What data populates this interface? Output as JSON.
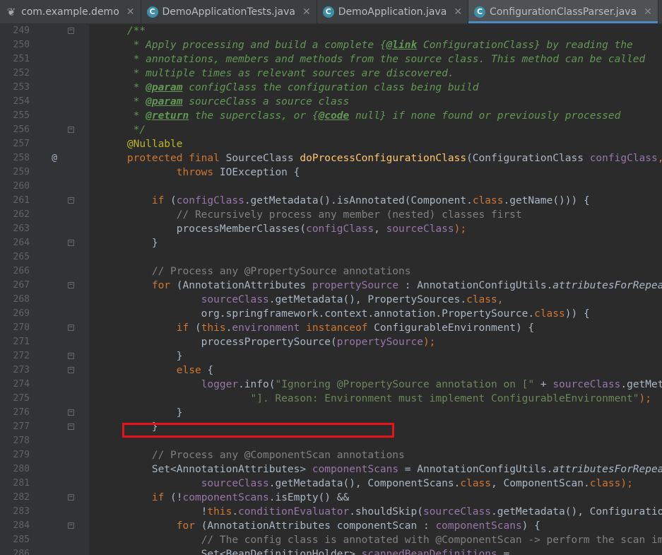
{
  "tabs": [
    {
      "label": "com.example.demo",
      "icon": "leaf-icon",
      "active": false
    },
    {
      "label": "DemoApplicationTests.java",
      "icon": "class-icon",
      "active": false
    },
    {
      "label": "DemoApplication.java",
      "icon": "spring-class-icon",
      "active": false
    },
    {
      "label": "ConfigurationClassParser.java",
      "icon": "class-icon",
      "active": true
    }
  ],
  "close_glyph": "✕",
  "gutter_marker": "@",
  "lines": [
    {
      "n": "249",
      "fold": "open",
      "tokens": [
        [
          "    ",
          "p"
        ],
        [
          "/**",
          "doc"
        ]
      ]
    },
    {
      "n": "250",
      "tokens": [
        [
          "     * Apply processing and build a complete ",
          "doc"
        ],
        [
          "{",
          "doc"
        ],
        [
          "@link",
          "doctag"
        ],
        [
          " ConfigurationClass",
          "doc"
        ],
        [
          "}",
          "doc"
        ],
        [
          " by reading the",
          "doc"
        ]
      ]
    },
    {
      "n": "251",
      "tokens": [
        [
          "     * annotations, members and methods from the source class. This method can be called",
          "doc"
        ]
      ]
    },
    {
      "n": "252",
      "tokens": [
        [
          "     * multiple times as relevant sources are discovered.",
          "doc"
        ]
      ]
    },
    {
      "n": "253",
      "tokens": [
        [
          "     * ",
          "doc"
        ],
        [
          "@param",
          "doctag"
        ],
        [
          " configClass",
          "doc"
        ],
        [
          " the configuration class being build",
          "doc"
        ]
      ]
    },
    {
      "n": "254",
      "tokens": [
        [
          "     * ",
          "doc"
        ],
        [
          "@param",
          "doctag"
        ],
        [
          " sourceClass",
          "doc"
        ],
        [
          " a source class",
          "doc"
        ]
      ]
    },
    {
      "n": "255",
      "tokens": [
        [
          "     * ",
          "doc"
        ],
        [
          "@return",
          "doctag"
        ],
        [
          " the superclass, or ",
          "doc"
        ],
        [
          "{",
          "doc"
        ],
        [
          "@code",
          "doctag"
        ],
        [
          " null",
          "doc"
        ],
        [
          "}",
          "doc"
        ],
        [
          " if none found or previously processed",
          "doc"
        ]
      ]
    },
    {
      "n": "256",
      "fold": "close",
      "tokens": [
        [
          "     */",
          "doc"
        ]
      ]
    },
    {
      "n": "257",
      "tokens": [
        [
          "    ",
          "p"
        ],
        [
          "@Nullable",
          "ann"
        ]
      ]
    },
    {
      "n": "258",
      "marker": true,
      "tokens": [
        [
          "    ",
          "p"
        ],
        [
          "protected final ",
          "kw"
        ],
        [
          "SourceClass ",
          "p"
        ],
        [
          "doProcessConfigurationClass",
          "method"
        ],
        [
          "(ConfigurationClass ",
          "p"
        ],
        [
          "configClass",
          "field"
        ],
        [
          ", SourceClass",
          "kw"
        ]
      ]
    },
    {
      "n": "259",
      "tokens": [
        [
          "            ",
          "p"
        ],
        [
          "throws ",
          "kw"
        ],
        [
          "IOException {",
          "p"
        ]
      ]
    },
    {
      "n": "260",
      "tokens": []
    },
    {
      "n": "261",
      "fold": "open",
      "tokens": [
        [
          "        ",
          "p"
        ],
        [
          "if ",
          "kw"
        ],
        [
          "(",
          "p"
        ],
        [
          "configClass",
          "field"
        ],
        [
          ".getMetadata().isAnnotated(",
          "p"
        ],
        [
          "Component",
          "p"
        ],
        [
          ".",
          "p"
        ],
        [
          "class",
          "kw"
        ],
        [
          ".getName())) {",
          "p"
        ]
      ]
    },
    {
      "n": "262",
      "tokens": [
        [
          "            ",
          "p"
        ],
        [
          "// Recursively process any member (nested) classes first",
          "com"
        ]
      ]
    },
    {
      "n": "263",
      "tokens": [
        [
          "            processMemberClasses(",
          "p"
        ],
        [
          "configClass",
          "field"
        ],
        [
          ", ",
          "p"
        ],
        [
          "sourceClass",
          "field"
        ],
        [
          ");",
          "kw"
        ]
      ]
    },
    {
      "n": "264",
      "fold": "close",
      "tokens": [
        [
          "        }",
          "p"
        ]
      ]
    },
    {
      "n": "265",
      "tokens": []
    },
    {
      "n": "266",
      "tokens": [
        [
          "        ",
          "p"
        ],
        [
          "// Process any @PropertySource annotations",
          "com"
        ]
      ]
    },
    {
      "n": "267",
      "fold": "open",
      "tokens": [
        [
          "        ",
          "p"
        ],
        [
          "for ",
          "kw"
        ],
        [
          "(AnnotationAttributes ",
          "p"
        ],
        [
          "propertySource",
          "field"
        ],
        [
          " : AnnotationConfigUtils.",
          "p"
        ],
        [
          "attributesForRepeatable(",
          "italic"
        ]
      ]
    },
    {
      "n": "268",
      "tokens": [
        [
          "                ",
          "p"
        ],
        [
          "sourceClass",
          "field"
        ],
        [
          ".getMetadata(), ",
          "p"
        ],
        [
          "PropertySources",
          "p"
        ],
        [
          ".",
          "p"
        ],
        [
          "class",
          "kw"
        ],
        [
          ",",
          "kw"
        ]
      ]
    },
    {
      "n": "269",
      "tokens": [
        [
          "                org.springframework.context.annotation.",
          "p"
        ],
        [
          "PropertySource",
          "p"
        ],
        [
          ".",
          "p"
        ],
        [
          "class",
          "kw"
        ],
        [
          ")) {",
          "p"
        ]
      ]
    },
    {
      "n": "270",
      "fold": "open",
      "tokens": [
        [
          "            ",
          "p"
        ],
        [
          "if ",
          "kw"
        ],
        [
          "(",
          "p"
        ],
        [
          "this",
          "kw"
        ],
        [
          ".",
          "p"
        ],
        [
          "environment",
          "field"
        ],
        [
          " instanceof ",
          "kw"
        ],
        [
          "ConfigurableEnvironment) {",
          "p"
        ]
      ]
    },
    {
      "n": "271",
      "tokens": [
        [
          "                processPropertySource(",
          "p"
        ],
        [
          "propertySource",
          "field"
        ],
        [
          ");",
          "kw"
        ]
      ]
    },
    {
      "n": "272",
      "fold": "close",
      "tokens": [
        [
          "            }",
          "p"
        ]
      ]
    },
    {
      "n": "273",
      "fold": "open",
      "tokens": [
        [
          "            ",
          "p"
        ],
        [
          "else ",
          "kw"
        ],
        [
          "{",
          "p"
        ]
      ]
    },
    {
      "n": "274",
      "tokens": [
        [
          "                ",
          "p"
        ],
        [
          "logger",
          "field"
        ],
        [
          ".info(",
          "p"
        ],
        [
          "\"Ignoring @PropertySource annotation on [\"",
          "str"
        ],
        [
          " + ",
          "p"
        ],
        [
          "sourceClass",
          "field"
        ],
        [
          ".getMetadata()",
          "p"
        ]
      ]
    },
    {
      "n": "275",
      "tokens": [
        [
          "                        ",
          "p"
        ],
        [
          "\"]. Reason: Environment must implement ConfigurableEnvironment\"",
          "str"
        ],
        [
          ");",
          "kw"
        ]
      ]
    },
    {
      "n": "276",
      "fold": "close",
      "tokens": [
        [
          "            }",
          "p"
        ]
      ]
    },
    {
      "n": "277",
      "fold": "close",
      "tokens": [
        [
          "        }",
          "p"
        ]
      ]
    },
    {
      "n": "278",
      "tokens": []
    },
    {
      "n": "279",
      "tokens": [
        [
          "        ",
          "p"
        ],
        [
          "// Process any @ComponentScan annotations",
          "com"
        ]
      ]
    },
    {
      "n": "280",
      "tokens": [
        [
          "        Set<",
          "p"
        ],
        [
          "AnnotationAttributes",
          "p"
        ],
        [
          "> ",
          "p"
        ],
        [
          "componentScans",
          "field"
        ],
        [
          " = AnnotationConfigUtils.",
          "p"
        ],
        [
          "attributesForRepeatable(",
          "italic"
        ]
      ]
    },
    {
      "n": "281",
      "tokens": [
        [
          "                ",
          "p"
        ],
        [
          "sourceClass",
          "field"
        ],
        [
          ".getMetadata(), ",
          "p"
        ],
        [
          "ComponentScans",
          "p"
        ],
        [
          ".",
          "p"
        ],
        [
          "class",
          "kw"
        ],
        [
          ", ",
          "p"
        ],
        [
          "ComponentScan",
          "p"
        ],
        [
          ".",
          "p"
        ],
        [
          "class",
          "kw"
        ],
        [
          ");",
          "kw"
        ]
      ]
    },
    {
      "n": "282",
      "fold": "open",
      "tokens": [
        [
          "        ",
          "p"
        ],
        [
          "if ",
          "kw"
        ],
        [
          "(!",
          "p"
        ],
        [
          "componentScans",
          "field"
        ],
        [
          ".isEmpty() &&",
          "p"
        ]
      ]
    },
    {
      "n": "283",
      "tokens": [
        [
          "                !",
          "p"
        ],
        [
          "this",
          "kw"
        ],
        [
          ".",
          "p"
        ],
        [
          "conditionEvaluator",
          "field"
        ],
        [
          ".shouldSkip(",
          "p"
        ],
        [
          "sourceClass",
          "field"
        ],
        [
          ".getMetadata(), ConfigurationPhase",
          "p"
        ]
      ]
    },
    {
      "n": "284",
      "fold": "open",
      "tokens": [
        [
          "            ",
          "p"
        ],
        [
          "for ",
          "kw"
        ],
        [
          "(AnnotationAttributes ",
          "p"
        ],
        [
          "componentScan",
          "p"
        ],
        [
          " : ",
          "p"
        ],
        [
          "componentScans",
          "field"
        ],
        [
          ") {",
          "p"
        ]
      ]
    },
    {
      "n": "285",
      "tokens": [
        [
          "                ",
          "p"
        ],
        [
          "// The config class is annotated with @ComponentScan -> perform the scan immediately",
          "com"
        ]
      ]
    },
    {
      "n": "286",
      "tokens": [
        [
          "                Set<BeanDefinitionHolder> ",
          "p"
        ],
        [
          "scannedBeanDefinitions",
          "field"
        ],
        [
          " =",
          "p"
        ]
      ]
    }
  ]
}
